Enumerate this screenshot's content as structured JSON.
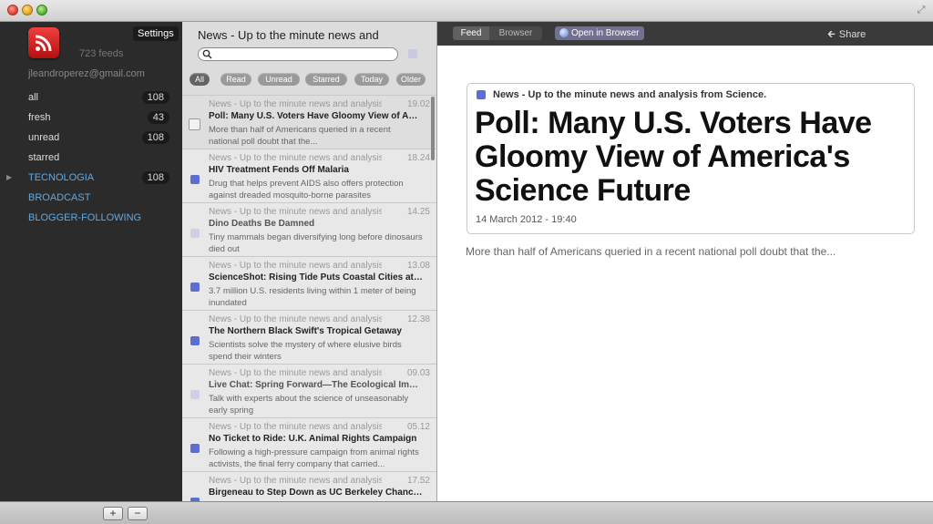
{
  "sidebar": {
    "settings_label": "Settings",
    "feeds_count": "723 feeds",
    "email": "jleandroperez@gmail.com",
    "items": [
      {
        "label": "all",
        "count": "108",
        "type": "plain"
      },
      {
        "label": "fresh",
        "count": "43",
        "type": "plain"
      },
      {
        "label": "unread",
        "count": "108",
        "type": "plain"
      },
      {
        "label": "starred",
        "count": "",
        "type": "plain"
      },
      {
        "label": "TECNOLOGIA",
        "count": "108",
        "type": "link",
        "expandable": true
      },
      {
        "label": "BROADCAST",
        "count": "",
        "type": "link"
      },
      {
        "label": "BLOGGER-FOLLOWING",
        "count": "",
        "type": "link"
      }
    ]
  },
  "list": {
    "title": "News - Up to the minute news and",
    "search_placeholder": "",
    "filters": [
      "All",
      "Read",
      "Unread",
      "Starred",
      "Today",
      "Older"
    ],
    "items": [
      {
        "source": "News - Up to the minute news and analysis",
        "time": "19.02",
        "title": "Poll: Many U.S. Voters Have Gloomy View of America's Science Future",
        "summary": "More than half of Americans queried in a recent national poll doubt that the...",
        "state": "selected"
      },
      {
        "source": "News - Up to the minute news and analysis",
        "time": "18.24",
        "title": "HIV Treatment Fends Off Malaria",
        "summary": "Drug that helps prevent AIDS also offers protection against dreaded mosquito-borne parasites",
        "state": "unread"
      },
      {
        "source": "News - Up to the minute news and analysis",
        "time": "14.25",
        "title": "Dino Deaths Be Damned",
        "summary": "Tiny mammals began diversifying long before dinosaurs died out",
        "state": "read"
      },
      {
        "source": "News - Up to the minute news and analysis",
        "time": "13.08",
        "title": "ScienceShot: Rising Tide Puts Coastal Cities at Risk",
        "summary": "3.7 million U.S. residents living within 1 meter of being inundated",
        "state": "unread"
      },
      {
        "source": "News - Up to the minute news and analysis",
        "time": "12.38",
        "title": "The Northern Black Swift's Tropical Getaway",
        "summary": "Scientists solve the mystery of where elusive birds spend their winters",
        "state": "unread"
      },
      {
        "source": "News - Up to the minute news and analysis",
        "time": "09.03",
        "title": "Live Chat: Spring Forward—The Ecological Impact",
        "summary": "Talk with experts about the science of unseasonably early spring",
        "state": "read"
      },
      {
        "source": "News - Up to the minute news and analysis",
        "time": "05.12",
        "title": "No Ticket to Ride: U.K. Animal Rights Campaign",
        "summary": "Following a high-pressure campaign from animal rights activists, the final ferry company that carried...",
        "state": "unread"
      },
      {
        "source": "News - Up to the minute news and analysis",
        "time": "17.52",
        "title": "Birgeneau to Step Down as UC Berkeley Chancellor",
        "summary": "",
        "state": "unread"
      }
    ]
  },
  "reader": {
    "tab_feed": "Feed",
    "tab_browser": "Browser",
    "open_in_browser": "Open in Browser",
    "share": "Share",
    "article": {
      "feed_name": "News - Up to the minute news and analysis from Science.",
      "headline": "Poll: Many U.S. Voters Have Gloomy View of America's Science Future",
      "date": "14 March 2012 - 19:40",
      "body": "More than half of Americans queried in a recent national poll doubt that the..."
    }
  },
  "bottombar": {
    "add_label": "+",
    "remove_label": "−"
  }
}
